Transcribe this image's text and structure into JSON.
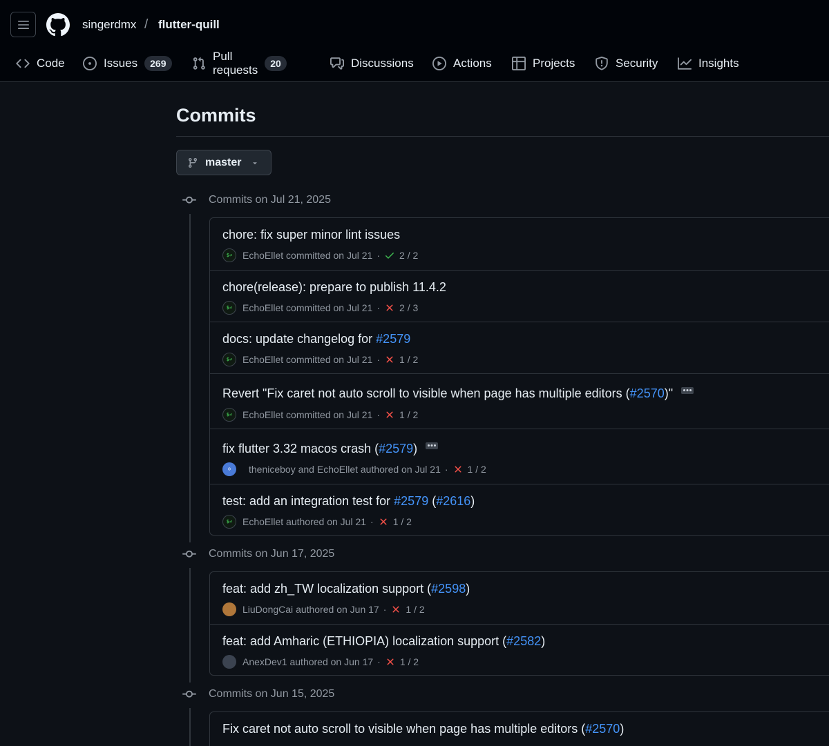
{
  "header": {
    "owner": "singerdmx",
    "separator": "/",
    "repo": "flutter-quill"
  },
  "tabs": [
    {
      "label": "Code",
      "icon": "code-icon"
    },
    {
      "label": "Issues",
      "icon": "issue-opened-icon",
      "count": "269"
    },
    {
      "label": "Pull requests",
      "icon": "git-pull-request-icon",
      "count": "20"
    },
    {
      "label": "Discussions",
      "icon": "comment-discussion-icon"
    },
    {
      "label": "Actions",
      "icon": "play-icon"
    },
    {
      "label": "Projects",
      "icon": "table-icon"
    },
    {
      "label": "Security",
      "icon": "shield-icon"
    },
    {
      "label": "Insights",
      "icon": "graph-icon"
    }
  ],
  "page": {
    "title": "Commits",
    "branch": "master"
  },
  "groups": [
    {
      "date_label": "Commits on Jul 21, 2025",
      "commits": [
        {
          "title_text": "chore: fix super minor lint issues",
          "author": "EchoEllet",
          "verb": "committed on Jul 21",
          "status": "success",
          "checks": "2 / 2"
        },
        {
          "title_text": "chore(release): prepare to publish 11.4.2",
          "author": "EchoEllet",
          "verb": "committed on Jul 21",
          "status": "failure",
          "checks": "2 / 3"
        },
        {
          "title_text": "docs: update changelog for ",
          "link": "#2579",
          "author": "EchoEllet",
          "verb": "committed on Jul 21",
          "status": "failure",
          "checks": "1 / 2"
        },
        {
          "title_text": "Revert \"Fix caret not auto scroll to visible when page has multiple editors (",
          "link": "#2570",
          "title_suffix": ")\"",
          "has_ellipsis": true,
          "author": "EchoEllet",
          "verb": "committed on Jul 21",
          "status": "failure",
          "checks": "1 / 2"
        },
        {
          "title_text": "fix flutter 3.32 macos crash (",
          "link": "#2579",
          "title_suffix": ")",
          "has_ellipsis": true,
          "author": "theniceboy and EchoEllet",
          "verb": "authored on Jul 21",
          "status": "failure",
          "checks": "1 / 2"
        },
        {
          "title_text": "test: add an integration test for ",
          "link": "#2579",
          "title_mid": " (",
          "link2": "#2616",
          "title_suffix": ")",
          "author": "EchoEllet",
          "verb": "authored on Jul 21",
          "status": "failure",
          "checks": "1 / 2"
        }
      ]
    },
    {
      "date_label": "Commits on Jun 17, 2025",
      "commits": [
        {
          "title_text": "feat: add zh_TW localization support (",
          "link": "#2598",
          "title_suffix": ")",
          "author": "LiuDongCai",
          "verb": "authored on Jun 17",
          "status": "failure",
          "checks": "1 / 2"
        },
        {
          "title_text": "feat: add Amharic (ETHIOPIA) localization support (",
          "link": "#2582",
          "title_suffix": ")",
          "author": "AnexDev1",
          "verb": "authored on Jun 17",
          "status": "failure",
          "checks": "1 / 2"
        }
      ]
    },
    {
      "date_label": "Commits on Jun 15, 2025",
      "commits": [
        {
          "title_text": "Fix caret not auto scroll to visible when page has multiple editors (",
          "link": "#2570",
          "title_suffix": ")"
        }
      ]
    }
  ],
  "colors": {
    "background": "#0d1117",
    "header_bg": "#010409",
    "link": "#4493f8",
    "success": "#3fb950",
    "failure": "#f85149",
    "muted": "#9198a1"
  }
}
